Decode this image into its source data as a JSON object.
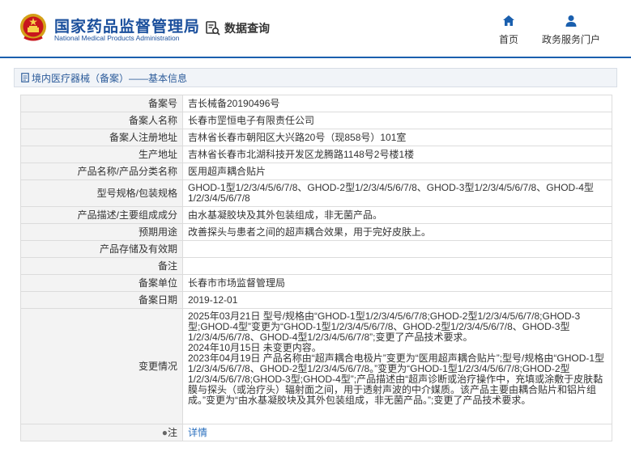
{
  "header": {
    "agency_cn": "国家药品监督管理局",
    "agency_en": "National Medical Products Administration",
    "data_query": "数据查询",
    "nav_home": "首页",
    "nav_portal": "政务服务门户"
  },
  "section": {
    "title": "境内医疗器械（备案）——基本信息"
  },
  "rows": [
    {
      "label": "备案号",
      "value": "吉长械备20190496号"
    },
    {
      "label": "备案人名称",
      "value": "长春市罡恒电子有限责任公司"
    },
    {
      "label": "备案人注册地址",
      "value": "吉林省长春市朝阳区大兴路20号（现858号）101室"
    },
    {
      "label": "生产地址",
      "value": "吉林省长春市北湖科技开发区龙腾路1148号2号楼1楼"
    },
    {
      "label": "产品名称/产品分类名称",
      "value": "医用超声耦合贴片"
    },
    {
      "label": "型号规格/包装规格",
      "value": "GHOD-1型1/2/3/4/5/6/7/8、GHOD-2型1/2/3/4/5/6/7/8、GHOD-3型1/2/3/4/5/6/7/8、GHOD-4型1/2/3/4/5/6/7/8"
    },
    {
      "label": "产品描述/主要组成成分",
      "value": "由水基凝胶块及其外包装组成，非无菌产品。"
    },
    {
      "label": "预期用途",
      "value": "改善探头与患者之间的超声耦合效果，用于完好皮肤上。"
    },
    {
      "label": "产品存储及有效期",
      "value": ""
    },
    {
      "label": "备注",
      "value": ""
    },
    {
      "label": "备案单位",
      "value": "长春市市场监督管理局"
    },
    {
      "label": "备案日期",
      "value": "2019-12-01"
    }
  ],
  "changes": {
    "label": "变更情况",
    "text": "2025年03月21日 型号/规格由“GHOD-1型1/2/3/4/5/6/7/8;GHOD-2型1/2/3/4/5/6/7/8;GHOD-3型;GHOD-4型”变更为“GHOD-1型1/2/3/4/5/6/7/8、GHOD-2型1/2/3/4/5/6/7/8、GHOD-3型1/2/3/4/5/6/7/8、GHOD-4型1/2/3/4/5/6/7/8”;变更了产品技术要求。\n2024年10月15日 未变更内容。\n2023年04月19日 产品名称由“超声耦合电极片”变更为“医用超声耦合贴片”;型号/规格由“GHOD-1型1/2/3/4/5/6/7/8、GHOD-2型1/2/3/4/5/6/7/8。”变更为“GHOD-1型1/2/3/4/5/6/7/8;GHOD-2型1/2/3/4/5/6/7/8;GHOD-3型;GHOD-4型”;产品描述由“超声诊断或治疗操作中，充填或涂敷于皮肤黏膜与探头（或治疗头）辐射面之间，用于透射声波的中介媒质。该产品主要由耦合贴片和铝片组成。”变更为“由水基凝胶块及其外包装组成，非无菌产品。”;变更了产品技术要求。"
  },
  "note_row": {
    "label": "注",
    "link": "详情"
  },
  "colors": {
    "brand_blue": "#1a4f9c",
    "header_rule": "#1a5fae",
    "link": "#2a6fbe",
    "label_bg": "#f3f3f3"
  },
  "icons": [
    "national-emblem-icon",
    "data-query-icon",
    "home-icon",
    "user-icon",
    "document-icon",
    "pin-icon"
  ]
}
